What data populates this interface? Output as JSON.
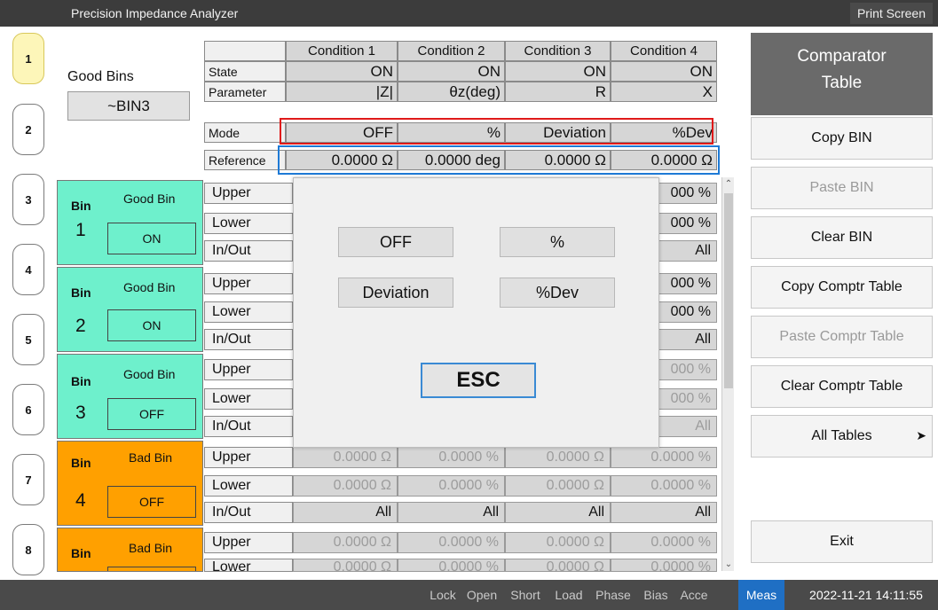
{
  "app_title": "Precision Impedance Analyzer",
  "print_screen_label": "Print Screen",
  "tabs": [
    "1",
    "2",
    "3",
    "4",
    "5",
    "6",
    "7",
    "8"
  ],
  "good_bins": {
    "label": "Good Bins",
    "value": "~BIN3"
  },
  "header_table": {
    "columns": [
      "Condition 1",
      "Condition 2",
      "Condition 3",
      "Condition 4"
    ],
    "rows": [
      {
        "label": "State",
        "values": [
          "ON",
          "ON",
          "ON",
          "ON"
        ]
      },
      {
        "label": "Parameter",
        "values": [
          "|Z|",
          "θz(deg)",
          "R",
          "X"
        ]
      },
      {
        "label": "Mode",
        "values": [
          "OFF",
          "%",
          "Deviation",
          "%Dev"
        ]
      },
      {
        "label": "Reference",
        "values": [
          "0.0000 Ω",
          "0.0000 deg",
          "0.0000 Ω",
          "0.0000 Ω"
        ]
      }
    ]
  },
  "bins": [
    {
      "tag": "Bin",
      "num": "1",
      "type": "Good Bin",
      "state": "ON",
      "color": "#6ef0cc"
    },
    {
      "tag": "Bin",
      "num": "2",
      "type": "Good Bin",
      "state": "ON",
      "color": "#6ef0cc"
    },
    {
      "tag": "Bin",
      "num": "3",
      "type": "Good Bin",
      "state": "OFF",
      "color": "#6ef0cc"
    },
    {
      "tag": "Bin",
      "num": "4",
      "type": "Bad Bin",
      "state": "OFF",
      "color": "#ffa000"
    },
    {
      "tag": "Bin",
      "num": "",
      "type": "Bad Bin",
      "state": "",
      "color": "#ffa000"
    }
  ],
  "row_labels": [
    "Upper",
    "Lower",
    "In/Out"
  ],
  "visible_right_values": {
    "bin1": [
      "000 %",
      "000 %",
      "All"
    ],
    "bin2": [
      "000 %",
      "000 %",
      "All"
    ],
    "bin3": [
      "000 %",
      "000 %",
      "All"
    ]
  },
  "bin4_values": {
    "upper": [
      "0.0000 Ω",
      "0.0000 %",
      "0.0000 Ω",
      "0.0000 %"
    ],
    "lower": [
      "0.0000 Ω",
      "0.0000 %",
      "0.0000 Ω",
      "0.0000 %"
    ],
    "inout": [
      "All",
      "All",
      "All",
      "All"
    ]
  },
  "bin5_values": {
    "upper": [
      "0.0000 Ω",
      "0.0000 %",
      "0.0000 Ω",
      "0.0000 %"
    ],
    "lower_partial": [
      "0.0000 Ω",
      "0.0000 %",
      "0.0000 Ω",
      "0.0000 %"
    ]
  },
  "right_panel": {
    "title_line1": "Comparator",
    "title_line2": "Table",
    "buttons": [
      {
        "label": "Copy BIN",
        "enabled": true
      },
      {
        "label": "Paste BIN",
        "enabled": false
      },
      {
        "label": "Clear BIN",
        "enabled": true
      },
      {
        "label": "Copy Comptr Table",
        "enabled": true
      },
      {
        "label": "Paste Comptr Table",
        "enabled": false
      },
      {
        "label": "Clear Comptr Table",
        "enabled": true
      },
      {
        "label": "All Tables",
        "enabled": true,
        "chevron": "➤"
      }
    ],
    "exit_label": "Exit"
  },
  "dialog": {
    "options": [
      "OFF",
      "%",
      "Deviation",
      "%Dev"
    ],
    "esc_label": "ESC"
  },
  "status_bar": {
    "items": [
      "Lock",
      "Open",
      "Short",
      "Load",
      "Phase",
      "Bias",
      "Acce",
      "Meas"
    ],
    "active": "Meas",
    "datetime": "2022-11-21 14:11:55"
  },
  "colors": {
    "good_bin": "#6ef0cc",
    "bad_bin": "#ffa000",
    "active_tab": "#fdf6b9",
    "accent": "#1f6fc4",
    "mode_highlight": "#e01919",
    "reference_highlight": "#1e7ad6"
  }
}
